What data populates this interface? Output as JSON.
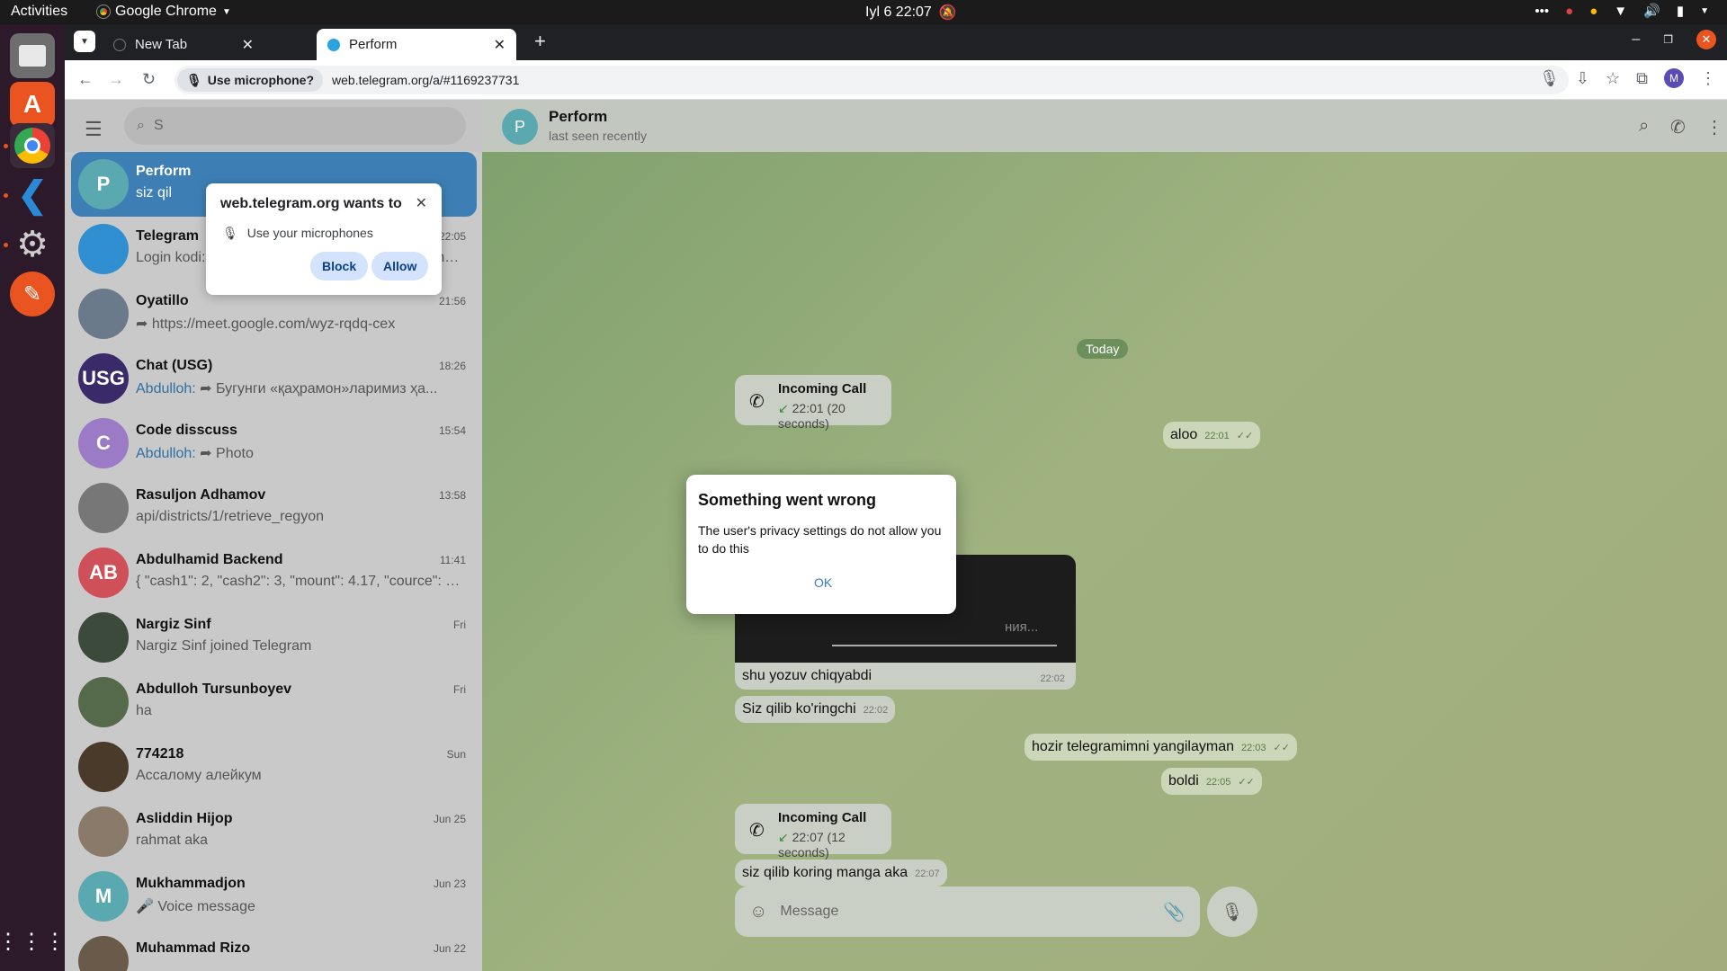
{
  "topbar": {
    "activities": "Activities",
    "app": "Google Chrome",
    "datetime": "Iyl 6  22:07"
  },
  "dock": {
    "icons": [
      "files-icon",
      "app-center-icon",
      "chrome-icon",
      "vscode-icon",
      "settings-icon",
      "edit-app-icon",
      "app-grid-icon"
    ]
  },
  "tabs": [
    {
      "title": "New Tab"
    },
    {
      "title": "Perform"
    }
  ],
  "toolbar": {
    "mic_chip": "Use microphone?",
    "url": "web.telegram.org/a/#1169237731",
    "profile_initial": "M"
  },
  "permission": {
    "title": "web.telegram.org wants to",
    "item": "Use your microphones",
    "block": "Block",
    "allow": "Allow"
  },
  "sidebar": {
    "search_placeholder": "S",
    "chats": [
      {
        "name": "Perform",
        "preview": "siz qil",
        "time": "",
        "initial": "P",
        "color": "#5aa8b0"
      },
      {
        "name": "Telegram",
        "preview": "Login kodi: ░░░░. Bu kodni hech kimga bermang...",
        "time": "22:05",
        "initial": "",
        "color": "#2f8fd0"
      },
      {
        "name": "Oyatillo",
        "preview": "➦ https://meet.google.com/wyz-rqdq-cex",
        "time": "21:56",
        "initial": "",
        "color": "#6b7a8a"
      },
      {
        "name": "Chat (USG)",
        "preview_sender": "Abdulloh:",
        "preview": "➦ Бугунги «қаҳрамон»ларимиз ҳа...",
        "time": "18:26",
        "initial": "USG",
        "color": "#3a2a6a"
      },
      {
        "name": "Code disscuss",
        "preview_sender": "Abdulloh:",
        "preview": "➦ Photo",
        "time": "15:54",
        "initial": "C",
        "color": "#9b7ac6"
      },
      {
        "name": "Rasuljon Adhamov",
        "preview": "api/districts/1/retrieve_regyon",
        "time": "13:58",
        "initial": "",
        "color": "#777"
      },
      {
        "name": "Abdulhamid Backend",
        "preview": "{ \"cash1\": 2, \"cash2\": 3, \"mount\": 4.17, \"cource\": 12...",
        "time": "11:41",
        "initial": "AB",
        "color": "#d0505a"
      },
      {
        "name": "Nargiz Sinf",
        "preview": "Nargiz Sinf joined Telegram",
        "time": "Fri",
        "initial": "",
        "color": "#3b4a3a"
      },
      {
        "name": "Abdulloh Tursunboyev",
        "preview": "ha",
        "time": "Fri",
        "initial": "",
        "color": "#556a4a"
      },
      {
        "name": "774218",
        "preview": "Ассалому алейкум",
        "time": "Sun",
        "initial": "",
        "color": "#4a3a2a"
      },
      {
        "name": "Asliddin Hijop",
        "preview": "rahmat aka",
        "time": "Jun 25",
        "initial": "",
        "color": "#8a7a6a"
      },
      {
        "name": "Mukhammadjon",
        "preview": "🎤 Voice message",
        "time": "Jun 23",
        "initial": "M",
        "color": "#5aa8b0"
      },
      {
        "name": "Muhammad Rizo",
        "preview": "",
        "time": "Jun 22",
        "initial": "",
        "color": "#6a5a4a"
      }
    ]
  },
  "chat": {
    "name": "Perform",
    "status": "last seen recently",
    "initial": "P",
    "date": "Today",
    "call1": {
      "title": "Incoming Call",
      "detail": "22:01 (20 seconds)"
    },
    "call2": {
      "title": "Incoming Call",
      "detail": "22:07 (12 seconds)"
    },
    "msgs": [
      {
        "text": "aloo",
        "time": "22:01"
      },
      {
        "text": "ния...",
        "time": ""
      },
      {
        "text": "shu yozuv chiqyabdi",
        "time": "22:02"
      },
      {
        "text": "Siz qilib ko'ringchi",
        "time": "22:02"
      },
      {
        "text": "hozir telegramimni yangilayman",
        "time": "22:03"
      },
      {
        "text": "boldi",
        "time": "22:05"
      },
      {
        "text": "siz qilib koring manga aka",
        "time": "22:07"
      }
    ],
    "composer_placeholder": "Message"
  },
  "dialog": {
    "title": "Something went wrong",
    "body": "The user's privacy settings do not allow you to do this",
    "ok": "OK"
  }
}
